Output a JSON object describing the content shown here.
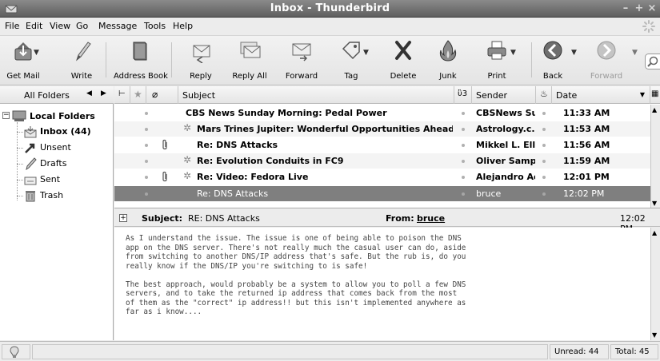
{
  "window": {
    "title": "Inbox - Thunderbird"
  },
  "menubar": [
    {
      "label": "File",
      "key": "menu-file"
    },
    {
      "label": "Edit",
      "key": "menu-edit"
    },
    {
      "label": "View",
      "key": "menu-view"
    },
    {
      "label": "Go",
      "key": "menu-go"
    },
    {
      "label": "Message",
      "key": "menu-message"
    },
    {
      "label": "Tools",
      "key": "menu-tools"
    },
    {
      "label": "Help",
      "key": "menu-help"
    }
  ],
  "toolbar": {
    "get_mail": "Get Mail",
    "write": "Write",
    "address_book": "Address Book",
    "reply": "Reply",
    "reply_all": "Reply All",
    "forward": "Forward",
    "tag": "Tag",
    "delete": "Delete",
    "junk": "Junk",
    "print": "Print",
    "back": "Back",
    "forward_nav": "Forward"
  },
  "folders": {
    "header": "All Folders",
    "account": "Local Folders",
    "items": [
      {
        "label": "Inbox (44)",
        "icon": "inbox-icon",
        "bold": true
      },
      {
        "label": "Unsent",
        "icon": "unsent-icon",
        "bold": false
      },
      {
        "label": "Drafts",
        "icon": "drafts-icon",
        "bold": false
      },
      {
        "label": "Sent",
        "icon": "sent-icon",
        "bold": false
      },
      {
        "label": "Trash",
        "icon": "trash-icon",
        "bold": false
      }
    ]
  },
  "threads": {
    "columns": {
      "subject": "Subject",
      "sender": "Sender",
      "date": "Date"
    },
    "rows": [
      {
        "subject": "CBS News Sunday Morning: Pedal Power",
        "sender": "CBSNews Su...",
        "date": "11:33 AM",
        "attach": false,
        "thread": false
      },
      {
        "subject": "Mars Trines Jupiter: Wonderful Opportunities Ahead!",
        "sender": "Astrology.c...",
        "date": "11:53 AM",
        "attach": false,
        "thread": true
      },
      {
        "subject": "Re: DNS Attacks",
        "sender": "Mikkel L. Ell...",
        "date": "11:56 AM",
        "attach": true,
        "thread": false
      },
      {
        "subject": "Re: Evolution Conduits in FC9",
        "sender": "Oliver Samp...",
        "date": "11:59 AM",
        "attach": false,
        "thread": true
      },
      {
        "subject": "Re: Video: Fedora Live",
        "sender": "Alejandro Ac...",
        "date": "12:01 PM",
        "attach": true,
        "thread": true
      },
      {
        "subject": "Re: DNS Attacks",
        "sender": "bruce",
        "date": "12:02 PM",
        "attach": false,
        "thread": false
      }
    ]
  },
  "message": {
    "subject_label": "Subject:",
    "subject": "RE: DNS Attacks",
    "from_label": "From:",
    "from": "bruce",
    "time": "12:02 PM",
    "body": "As I understand the issue. The issue is one of being able to poison the DNS\napp on the DNS server. There's not really much the casual user can do, aside\nfrom switching to another DNS/IP address that's safe. But the rub is, do you\nreally know if the DNS/IP you're switching to is safe!\n\nThe best approach, would probably be a system to allow you to poll a few DNS\nservers, and to take the returned ip address that comes back from the most\nof them as the \"correct\" ip address!! but this isn't implemented anywhere as\nfar as i know...."
  },
  "status": {
    "unread": "Unread: 44",
    "total": "Total: 45"
  }
}
